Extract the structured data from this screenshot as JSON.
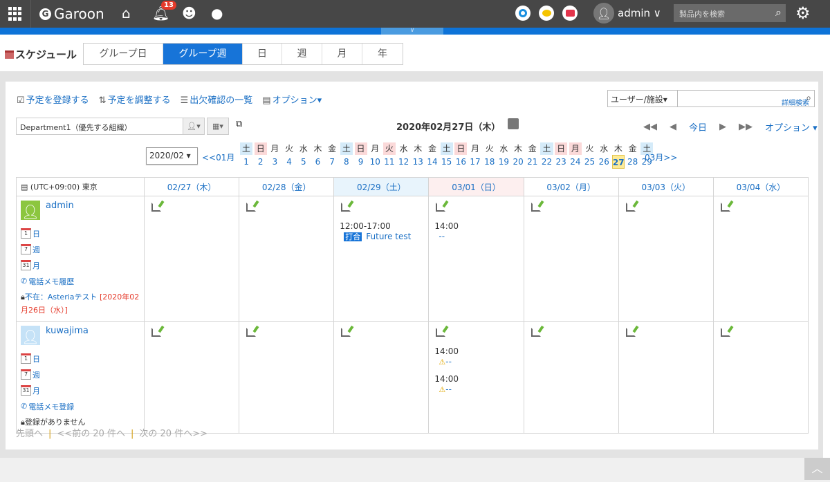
{
  "topbar": {
    "app_name": "Garoon",
    "notification_count": "13",
    "user": "admin",
    "search_placeholder": "製品内を検索"
  },
  "header": {
    "title": "スケジュール",
    "tabs": [
      {
        "label": "グループ日"
      },
      {
        "label": "グループ週",
        "active": true
      },
      {
        "label": "日"
      },
      {
        "label": "週"
      },
      {
        "label": "月"
      },
      {
        "label": "年"
      }
    ]
  },
  "toolbar": {
    "register": "予定を登録する",
    "adjust": "予定を調整する",
    "attendance": "出欠確認の一覧",
    "options": "オプション▾",
    "user_facility": "ユーザー/施設▾",
    "advanced_search": "詳細検索"
  },
  "filter": {
    "department": "Department1（優先する組織）",
    "date_title": "2020年02月27日（木）",
    "today": "今日",
    "options": "オプション ▾",
    "month_select": "2020/02 ▾",
    "prev_month": "<<01月",
    "next_month": "03月>>"
  },
  "days": [
    {
      "w": "土",
      "n": "1",
      "t": "sat"
    },
    {
      "w": "日",
      "n": "2",
      "t": "sun"
    },
    {
      "w": "月",
      "n": "3"
    },
    {
      "w": "火",
      "n": "4"
    },
    {
      "w": "水",
      "n": "5"
    },
    {
      "w": "木",
      "n": "6"
    },
    {
      "w": "金",
      "n": "7"
    },
    {
      "w": "土",
      "n": "8",
      "t": "sat"
    },
    {
      "w": "日",
      "n": "9",
      "t": "sun"
    },
    {
      "w": "月",
      "n": "10"
    },
    {
      "w": "火",
      "n": "11",
      "t": "sun"
    },
    {
      "w": "水",
      "n": "12"
    },
    {
      "w": "木",
      "n": "13"
    },
    {
      "w": "金",
      "n": "14"
    },
    {
      "w": "土",
      "n": "15",
      "t": "sat"
    },
    {
      "w": "日",
      "n": "16",
      "t": "sun"
    },
    {
      "w": "月",
      "n": "17"
    },
    {
      "w": "火",
      "n": "18"
    },
    {
      "w": "水",
      "n": "19"
    },
    {
      "w": "木",
      "n": "20"
    },
    {
      "w": "金",
      "n": "21"
    },
    {
      "w": "土",
      "n": "22",
      "t": "sat"
    },
    {
      "w": "日",
      "n": "23",
      "t": "sun"
    },
    {
      "w": "月",
      "n": "24",
      "t": "sun"
    },
    {
      "w": "火",
      "n": "25"
    },
    {
      "w": "水",
      "n": "26"
    },
    {
      "w": "木",
      "n": "27",
      "today": true
    },
    {
      "w": "金",
      "n": "28"
    },
    {
      "w": "土",
      "n": "29",
      "t": "sat"
    }
  ],
  "table": {
    "timezone": "(UTC+09:00) 東京",
    "columns": [
      {
        "label": "02/27（木）"
      },
      {
        "label": "02/28（金）"
      },
      {
        "label": "02/29（土）",
        "t": "sat"
      },
      {
        "label": "03/01（日）",
        "t": "sun"
      },
      {
        "label": "03/02（月）"
      },
      {
        "label": "03/03（火）"
      },
      {
        "label": "03/04（水）"
      }
    ],
    "users": [
      {
        "name": "admin",
        "avatar_color": "#8cc63f",
        "links": [
          "日",
          "週",
          "月"
        ],
        "phone": "電話メモ履歴",
        "absence": "不在：Asteriaテスト",
        "absence_date": "[2020年02月26日（水）]",
        "events": {
          "2": [
            {
              "time": "12:00-17:00",
              "tag": "打合",
              "title": "Future test"
            }
          ],
          "3": [
            {
              "time": "14:00",
              "title": "--"
            }
          ]
        }
      },
      {
        "name": "kuwajima",
        "avatar_color": "#c5e2f7",
        "links": [
          "日",
          "週",
          "月"
        ],
        "phone": "電話メモ登録",
        "absence": "登録がありません",
        "absence_date": "",
        "events": {
          "3": [
            {
              "time": "14:00",
              "title": "--",
              "warn": true
            },
            {
              "time": "14:00",
              "title": "--",
              "warn": true
            }
          ]
        }
      }
    ]
  },
  "pager": {
    "first": "先頭へ",
    "prev": "<<前の 20 件へ",
    "next": "次の 20 件へ>>"
  }
}
